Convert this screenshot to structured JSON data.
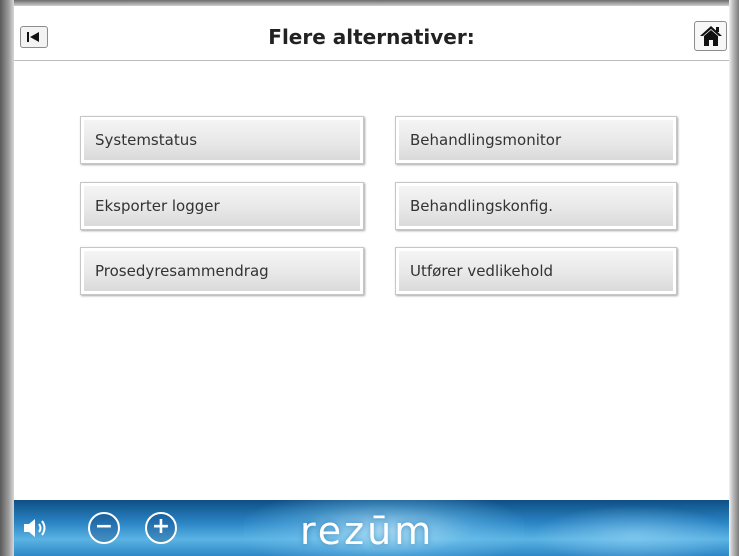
{
  "header": {
    "title": "Flere alternativer:",
    "back_icon": "skip-back-icon",
    "home_icon": "home-icon"
  },
  "menu": {
    "items": [
      {
        "label": "Systemstatus"
      },
      {
        "label": "Behandlingsmonitor"
      },
      {
        "label": "Eksporter logger"
      },
      {
        "label": "Behandlingskonfig."
      },
      {
        "label": "Prosedyresammendrag"
      },
      {
        "label": "Utfører vedlikehold"
      }
    ]
  },
  "footer": {
    "speaker_icon": "speaker-icon",
    "minus_label": "−",
    "plus_label": "+",
    "brand": "rezūm"
  },
  "colors": {
    "footer_dark": "#0f4f86",
    "footer_light": "#5ab3e3",
    "button_face": "#e8e8e8"
  }
}
